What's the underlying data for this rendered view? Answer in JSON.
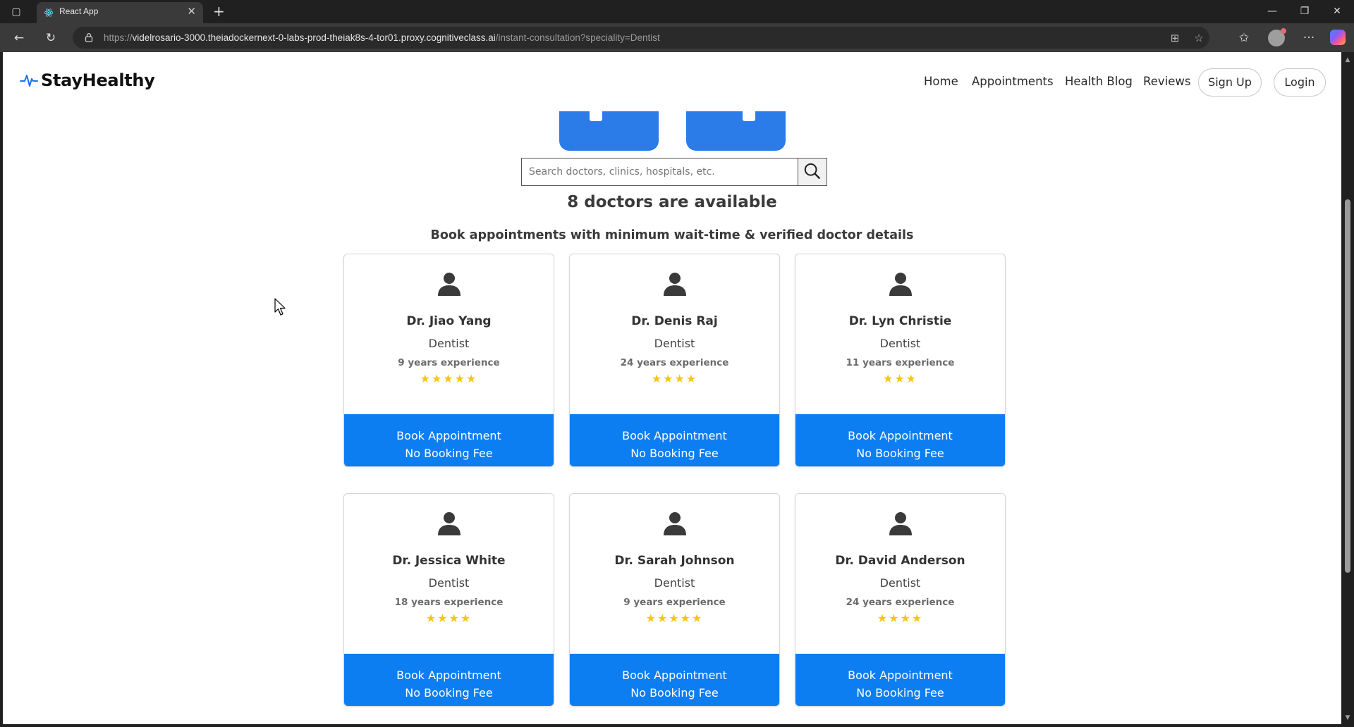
{
  "browser": {
    "tab_title": "React App",
    "url_host": "videlrosario-3000.theiadockernext-0-labs-prod-theiak8s-4-tor01.proxy.cognitiveclass.ai",
    "url_prefix": "https://",
    "url_path": "/instant-consultation?speciality=Dentist"
  },
  "navbar": {
    "logo": "StayHealthy",
    "links": [
      "Home",
      "Appointments",
      "Health Blog",
      "Reviews"
    ],
    "signup": "Sign Up",
    "login": "Login"
  },
  "search": {
    "placeholder": "Search doctors, clinics, hospitals, etc."
  },
  "heading": "8 doctors are available",
  "subheading": "Book appointments with minimum wait-time & verified doctor details",
  "book_label_1": "Book Appointment",
  "book_label_2": "No Booking Fee",
  "star_color": "#f5c518",
  "button_color": "#0d7df2",
  "doctors": [
    {
      "name": "Dr. Jiao Yang",
      "speciality": "Dentist",
      "experience": "9 years experience",
      "rating": 5
    },
    {
      "name": "Dr. Denis Raj",
      "speciality": "Dentist",
      "experience": "24 years experience",
      "rating": 4
    },
    {
      "name": "Dr. Lyn Christie",
      "speciality": "Dentist",
      "experience": "11 years experience",
      "rating": 3
    },
    {
      "name": "Dr. Jessica White",
      "speciality": "Dentist",
      "experience": "18 years experience",
      "rating": 4
    },
    {
      "name": "Dr. Sarah Johnson",
      "speciality": "Dentist",
      "experience": "9 years experience",
      "rating": 5
    },
    {
      "name": "Dr. David Anderson",
      "speciality": "Dentist",
      "experience": "24 years experience",
      "rating": 4
    }
  ]
}
